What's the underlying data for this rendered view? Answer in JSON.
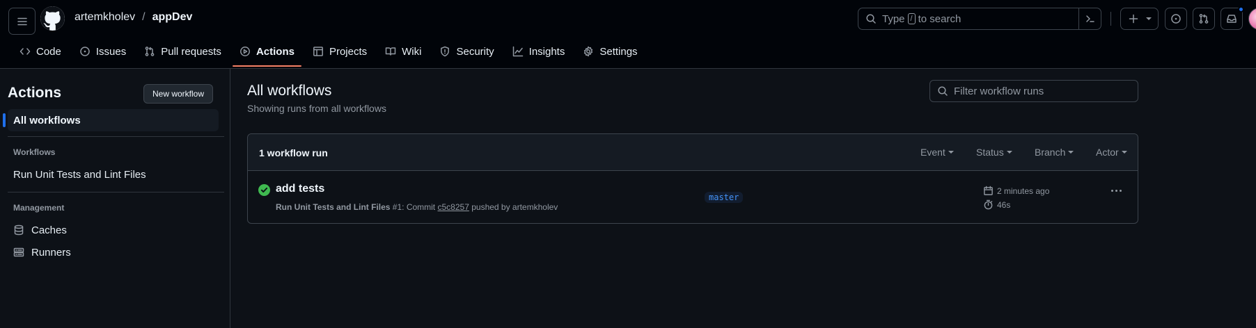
{
  "header": {
    "owner": "artemkholev",
    "separator": "/",
    "repo": "appDev",
    "search_prefix": "Type",
    "search_key": "/",
    "search_suffix": "to search"
  },
  "tabs": [
    {
      "label": "Code",
      "icon": "code-icon"
    },
    {
      "label": "Issues",
      "icon": "issue-icon"
    },
    {
      "label": "Pull requests",
      "icon": "pull-request-icon"
    },
    {
      "label": "Actions",
      "icon": "play-icon",
      "active": true
    },
    {
      "label": "Projects",
      "icon": "table-icon"
    },
    {
      "label": "Wiki",
      "icon": "book-icon"
    },
    {
      "label": "Security",
      "icon": "shield-icon"
    },
    {
      "label": "Insights",
      "icon": "graph-icon"
    },
    {
      "label": "Settings",
      "icon": "gear-icon"
    }
  ],
  "sidebar": {
    "title": "Actions",
    "new_workflow": "New workflow",
    "all_workflows": "All workflows",
    "workflows_heading": "Workflows",
    "workflow_item": "Run Unit Tests and Lint Files",
    "management_heading": "Management",
    "caches": "Caches",
    "runners": "Runners"
  },
  "main": {
    "title": "All workflows",
    "subtitle": "Showing runs from all workflows",
    "filter_placeholder": "Filter workflow runs",
    "count": "1 workflow run",
    "filters": [
      "Event",
      "Status",
      "Branch",
      "Actor"
    ],
    "run": {
      "title": "add tests",
      "workflow": "Run Unit Tests and Lint Files",
      "number": "#1: Commit",
      "commit": "c5c8257",
      "pushed": "pushed by artemkholev",
      "branch": "master",
      "when": "2 minutes ago",
      "duration": "46s",
      "status": "success"
    }
  },
  "colors": {
    "accent": "#f78166",
    "success": "#3fb950",
    "link": "#4493f8",
    "selection_bar": "#1f6feb"
  }
}
